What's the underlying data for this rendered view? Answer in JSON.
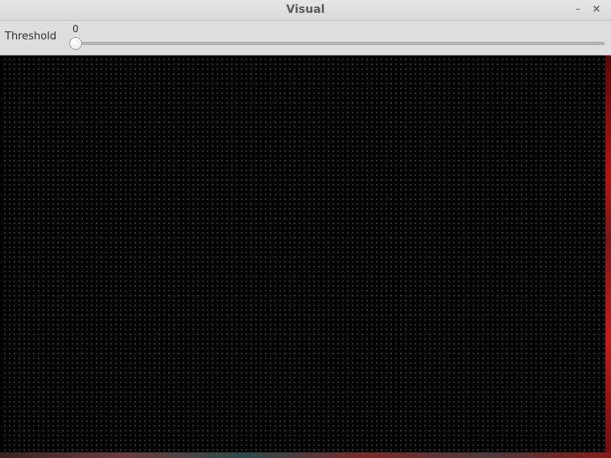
{
  "window": {
    "title": "Visual",
    "minimize_glyph": "–",
    "close_glyph": "×"
  },
  "controls": {
    "threshold_label": "Threshold",
    "slider_value": "0",
    "slider_fraction": 0
  },
  "icons": {
    "minimize": "minimize-icon",
    "close": "close-icon"
  },
  "colors": {
    "titlebar_bg": "#dddddd",
    "viewport_bg": "#000000",
    "edge_accent": "#b01818"
  }
}
